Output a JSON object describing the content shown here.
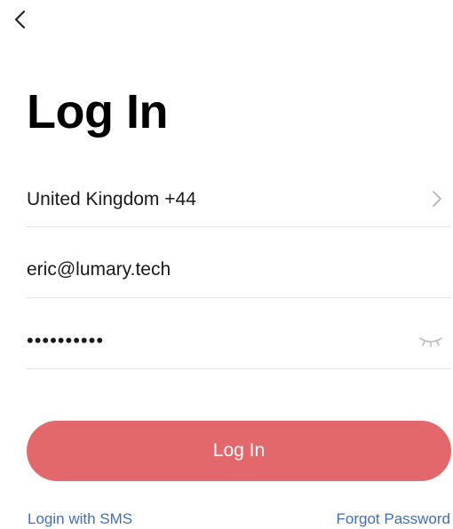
{
  "header": {
    "back_icon": "chevron-left-icon",
    "title": "Log In"
  },
  "form": {
    "region": {
      "value": "United Kingdom +44",
      "icon": "chevron-right-icon"
    },
    "email": {
      "value": "eric@lumary.tech"
    },
    "password": {
      "value": "••••••••••",
      "icon": "eye-closed-icon"
    }
  },
  "actions": {
    "login_label": "Log In",
    "login_color": "#e3686b",
    "sms_link": "Login with SMS",
    "forgot_link": "Forgot Password",
    "link_color": "#3e6fbd"
  }
}
